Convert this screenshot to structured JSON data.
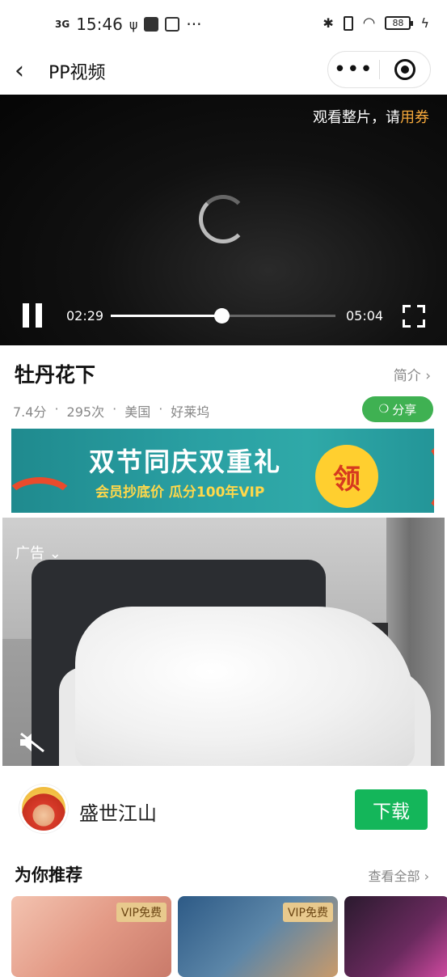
{
  "status_bar": {
    "signal": "3G",
    "time": "15:46",
    "battery": "88"
  },
  "nav": {
    "back_label": "‹",
    "title": "PP视频",
    "more_label": "•••"
  },
  "player": {
    "coupon_prefix": "观看整片，请",
    "coupon_highlight": "用券",
    "current_time": "02:29",
    "duration": "05:04",
    "progress_fraction": 0.493
  },
  "info": {
    "title": "牡丹花下",
    "intro_label": "简介 ›",
    "rating": "7.4分",
    "views": "295次",
    "region": "美国",
    "category": "好莱坞",
    "share_label": "分享"
  },
  "banner": {
    "headline": "双节同庆双重礼",
    "subline": "会员抄底价  瓜分100年VIP",
    "claim": "领"
  },
  "ad": {
    "label": "广告 ⌄"
  },
  "author": {
    "name": "盛世江山",
    "download_label": "下载"
  },
  "recommend": {
    "title": "为你推荐",
    "view_all": "查看全部 ›",
    "items": [
      {
        "badge": "VIP免费"
      },
      {
        "badge": "VIP免费"
      },
      {
        "badge": ""
      }
    ]
  },
  "colors": {
    "accent_green": "#14b65a",
    "share_green": "#3fb152",
    "coupon_orange": "#f7a93b"
  }
}
